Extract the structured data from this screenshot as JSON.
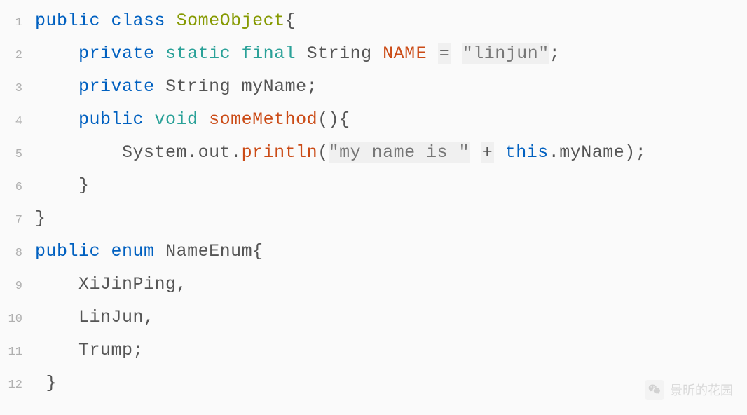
{
  "code": {
    "lines": [
      {
        "num": "1",
        "tokens": [
          {
            "t": "public",
            "cls": "kw-blue"
          },
          {
            "t": " ",
            "cls": ""
          },
          {
            "t": "class",
            "cls": "kw-blue"
          },
          {
            "t": " ",
            "cls": ""
          },
          {
            "t": "SomeObject",
            "cls": "ident-green"
          },
          {
            "t": "{",
            "cls": "punct"
          }
        ]
      },
      {
        "num": "2",
        "tokens": [
          {
            "t": "    ",
            "cls": ""
          },
          {
            "t": "private",
            "cls": "kw-blue"
          },
          {
            "t": " ",
            "cls": ""
          },
          {
            "t": "static",
            "cls": "kw-teal"
          },
          {
            "t": " ",
            "cls": ""
          },
          {
            "t": "final",
            "cls": "kw-teal"
          },
          {
            "t": " ",
            "cls": ""
          },
          {
            "t": "String",
            "cls": "text-gray"
          },
          {
            "t": " ",
            "cls": ""
          },
          {
            "t": "NAM",
            "cls": "method-red"
          },
          {
            "t": "|CURSOR|",
            "cls": ""
          },
          {
            "t": "E",
            "cls": "method-red"
          },
          {
            "t": " ",
            "cls": ""
          },
          {
            "t": "=",
            "cls": "op op-bg"
          },
          {
            "t": " ",
            "cls": ""
          },
          {
            "t": "\"linjun\"",
            "cls": "str str-bg"
          },
          {
            "t": ";",
            "cls": "punct"
          }
        ]
      },
      {
        "num": "3",
        "tokens": [
          {
            "t": "    ",
            "cls": ""
          },
          {
            "t": "private",
            "cls": "kw-blue"
          },
          {
            "t": " ",
            "cls": ""
          },
          {
            "t": "String",
            "cls": "text-gray"
          },
          {
            "t": " ",
            "cls": ""
          },
          {
            "t": "myName",
            "cls": "text-gray"
          },
          {
            "t": ";",
            "cls": "punct"
          }
        ]
      },
      {
        "num": "4",
        "tokens": [
          {
            "t": "    ",
            "cls": ""
          },
          {
            "t": "public",
            "cls": "kw-blue"
          },
          {
            "t": " ",
            "cls": ""
          },
          {
            "t": "void",
            "cls": "kw-teal"
          },
          {
            "t": " ",
            "cls": ""
          },
          {
            "t": "someMethod",
            "cls": "method-red"
          },
          {
            "t": "(){",
            "cls": "punct"
          }
        ]
      },
      {
        "num": "5",
        "tokens": [
          {
            "t": "        ",
            "cls": ""
          },
          {
            "t": "System",
            "cls": "text-gray"
          },
          {
            "t": ".",
            "cls": "punct"
          },
          {
            "t": "out",
            "cls": "text-gray"
          },
          {
            "t": ".",
            "cls": "punct"
          },
          {
            "t": "println",
            "cls": "method-red"
          },
          {
            "t": "(",
            "cls": "paren"
          },
          {
            "t": "\"my name is \"",
            "cls": "str str-bg"
          },
          {
            "t": " ",
            "cls": ""
          },
          {
            "t": "+",
            "cls": "op op-bg"
          },
          {
            "t": " ",
            "cls": ""
          },
          {
            "t": "this",
            "cls": "kw-blue"
          },
          {
            "t": ".",
            "cls": "punct"
          },
          {
            "t": "myName",
            "cls": "text-gray"
          },
          {
            "t": ");",
            "cls": "punct"
          }
        ]
      },
      {
        "num": "6",
        "tokens": [
          {
            "t": "    }",
            "cls": "punct"
          }
        ]
      },
      {
        "num": "7",
        "tokens": [
          {
            "t": "}",
            "cls": "punct"
          }
        ]
      },
      {
        "num": "8",
        "tokens": [
          {
            "t": "public",
            "cls": "kw-blue"
          },
          {
            "t": " ",
            "cls": ""
          },
          {
            "t": "enum",
            "cls": "kw-blue"
          },
          {
            "t": " ",
            "cls": ""
          },
          {
            "t": "NameEnum",
            "cls": "text-gray"
          },
          {
            "t": "{",
            "cls": "punct"
          }
        ]
      },
      {
        "num": "9",
        "tokens": [
          {
            "t": "    ",
            "cls": ""
          },
          {
            "t": "XiJinPing",
            "cls": "text-gray"
          },
          {
            "t": ",",
            "cls": "punct"
          }
        ]
      },
      {
        "num": "10",
        "tokens": [
          {
            "t": "    ",
            "cls": ""
          },
          {
            "t": "LinJun",
            "cls": "text-gray"
          },
          {
            "t": ",",
            "cls": "punct"
          }
        ]
      },
      {
        "num": "11",
        "tokens": [
          {
            "t": "    ",
            "cls": ""
          },
          {
            "t": "Trump",
            "cls": "text-gray"
          },
          {
            "t": ";",
            "cls": "punct"
          }
        ]
      },
      {
        "num": "12",
        "tokens": [
          {
            "t": " }",
            "cls": "punct"
          }
        ]
      }
    ]
  },
  "watermark": {
    "text": "景昕的花园"
  }
}
